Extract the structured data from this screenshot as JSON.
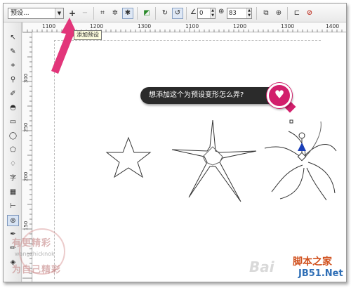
{
  "toolbar": {
    "preset_value": "预设...",
    "add_preset_icon": "plus-icon",
    "remove_preset_icon": "minus-icon",
    "angle_value": "0",
    "spin_value": "83",
    "tooltip": "添加预设"
  },
  "rulers": {
    "top_labels": [
      "1100",
      "1200",
      "1300",
      "1100",
      "1200",
      "1300",
      "1400"
    ],
    "left_labels": [
      "300",
      "250",
      "200",
      "150"
    ]
  },
  "canvas": {
    "bubble_text": "想添加这个为预设变形怎么弄?",
    "bubble_icon": "heart-icon"
  },
  "watermarks": {
    "left_line1": "有更精彩",
    "left_line2": "wangzhicknok",
    "left_line3": "为自己精彩",
    "right_baidu": "Bai",
    "right_site_cn": "脚本之家",
    "right_site_url": "JB51.Net"
  },
  "colors": {
    "accent_pink": "#d21f6c",
    "arrow_pink": "#e2357a",
    "bubble_bg": "#2b2b2b",
    "selection_blue": "#1a3fb8"
  }
}
